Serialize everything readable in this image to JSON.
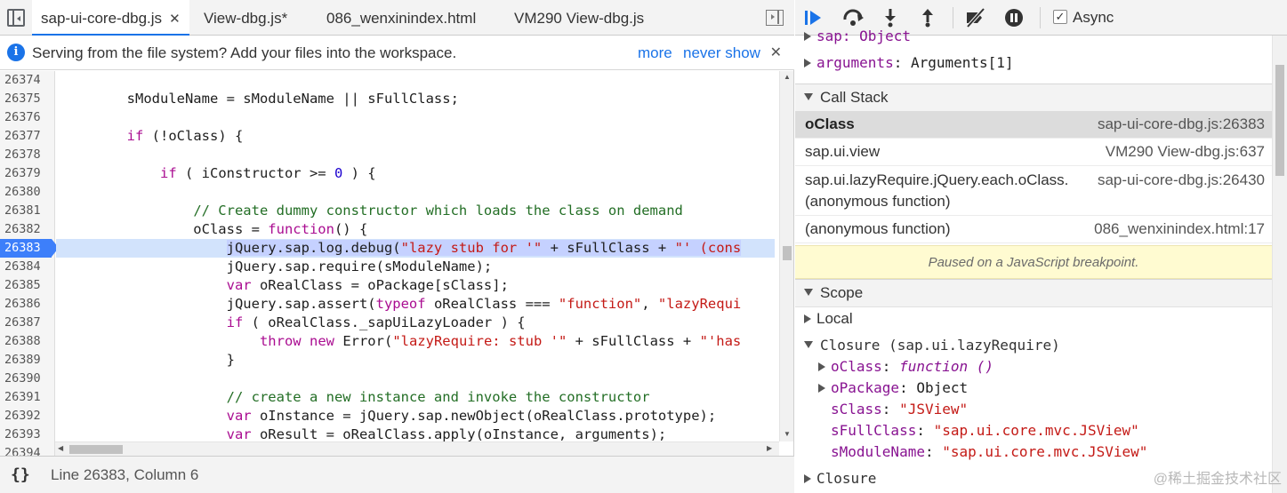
{
  "tabs": [
    {
      "label": "sap-ui-core-dbg.js",
      "close": "✕",
      "active": true
    },
    {
      "label": "View-dbg.js*",
      "active": false
    },
    {
      "label": "086_wenxinindex.html",
      "active": false
    },
    {
      "label": "VM290 View-dbg.js",
      "active": false
    }
  ],
  "infobar": {
    "text": "Serving from the file system? Add your files into the workspace.",
    "more": "more",
    "never_show": "never show",
    "close": "✕"
  },
  "editor": {
    "current_line": "26383",
    "lines": [
      {
        "no": "26374",
        "html": ""
      },
      {
        "no": "26375",
        "html": "        sModuleName = sModuleName || sFullClass;"
      },
      {
        "no": "26376",
        "html": ""
      },
      {
        "no": "26377",
        "html": "        <span class=\"kw\">if</span> (!oClass) {"
      },
      {
        "no": "26378",
        "html": ""
      },
      {
        "no": "26379",
        "html": "            <span class=\"kw\">if</span> ( iConstructor >= <span class=\"num\">0</span> ) {"
      },
      {
        "no": "26380",
        "html": ""
      },
      {
        "no": "26381",
        "html": "                <span class=\"cm\">// Create dummy constructor which loads the class on demand</span>"
      },
      {
        "no": "26382",
        "html": "                oClass = <span class=\"kw\">function</span>() {"
      },
      {
        "no": "26383",
        "html": "                    <span class=\"hl\">jQuery.sap.log.debug(<span class=\"str\">\"lazy stub for '\"</span> + sFullClass + <span class=\"str\">\"' (cons</span></span>"
      },
      {
        "no": "26384",
        "html": "                    jQuery.sap.require(sModuleName);"
      },
      {
        "no": "26385",
        "html": "                    <span class=\"kw\">var</span> oRealClass = oPackage[sClass];"
      },
      {
        "no": "26386",
        "html": "                    jQuery.sap.assert(<span class=\"kw\">typeof</span> oRealClass === <span class=\"str\">\"function\"</span>, <span class=\"str\">\"lazyRequi</span>"
      },
      {
        "no": "26387",
        "html": "                    <span class=\"kw\">if</span> ( oRealClass._sapUiLazyLoader ) {"
      },
      {
        "no": "26388",
        "html": "                        <span class=\"kw\">throw</span> <span class=\"kw\">new</span> Error(<span class=\"str\">\"lazyRequire: stub '\"</span> + sFullClass + <span class=\"str\">\"'has</span>"
      },
      {
        "no": "26389",
        "html": "                    }"
      },
      {
        "no": "26390",
        "html": ""
      },
      {
        "no": "26391",
        "html": "                    <span class=\"cm\">// create a new instance and invoke the constructor</span>"
      },
      {
        "no": "26392",
        "html": "                    <span class=\"kw\">var</span> oInstance = jQuery.sap.newObject(oRealClass.prototype);"
      },
      {
        "no": "26393",
        "html": "                    <span class=\"kw\">var</span> oResult = oRealClass.apply(oInstance, arguments);"
      },
      {
        "no": "26394",
        "html": ""
      }
    ]
  },
  "statusbar": {
    "format_icon": "{}",
    "position": "Line 26383, Column 6"
  },
  "debugger": {
    "async_label": "Async",
    "async_checked": "✓",
    "top_partial": "sap: Object",
    "arguments": {
      "key": "arguments",
      "value": "Arguments[1]"
    },
    "call_stack_title": "Call Stack",
    "call_stack": [
      {
        "fn": "oClass",
        "loc": "sap-ui-core-dbg.js:26383",
        "selected": true
      },
      {
        "fn": "sap.ui.view",
        "loc": "VM290 View-dbg.js:637"
      },
      {
        "fn": "sap.ui.lazyRequire.jQuery.each.oClass.",
        "fn2": "(anonymous function)",
        "loc": "sap-ui-core-dbg.js:26430"
      },
      {
        "fn": "(anonymous function)",
        "loc": "086_wenxinindex.html:17"
      }
    ],
    "paused_text": "Paused on a JavaScript breakpoint.",
    "scope_title": "Scope",
    "scope_local": "Local",
    "scope_closure_title": "Closure (sap.ui.lazyRequire)",
    "closure_vars": [
      {
        "key": "oClass",
        "value": "function ()",
        "kind": "fn",
        "expandable": true
      },
      {
        "key": "oPackage",
        "value": "Object",
        "kind": "obj",
        "expandable": true
      },
      {
        "key": "sClass",
        "value": "\"JSView\"",
        "kind": "str",
        "expandable": false
      },
      {
        "key": "sFullClass",
        "value": "\"sap.ui.core.mvc.JSView\"",
        "kind": "str",
        "expandable": false
      },
      {
        "key": "sModuleName",
        "value": "\"sap.ui.core.mvc.JSView\"",
        "kind": "str",
        "expandable": false
      }
    ],
    "closure_last": "Closure",
    "watermark": "@稀土掘金技术社区"
  },
  "colors": {
    "accent": "#1a73e8",
    "current_line_bg": "#d2e3fc",
    "gutter_marker": "#3d7ffa",
    "paused_bg": "#fffbd1"
  }
}
